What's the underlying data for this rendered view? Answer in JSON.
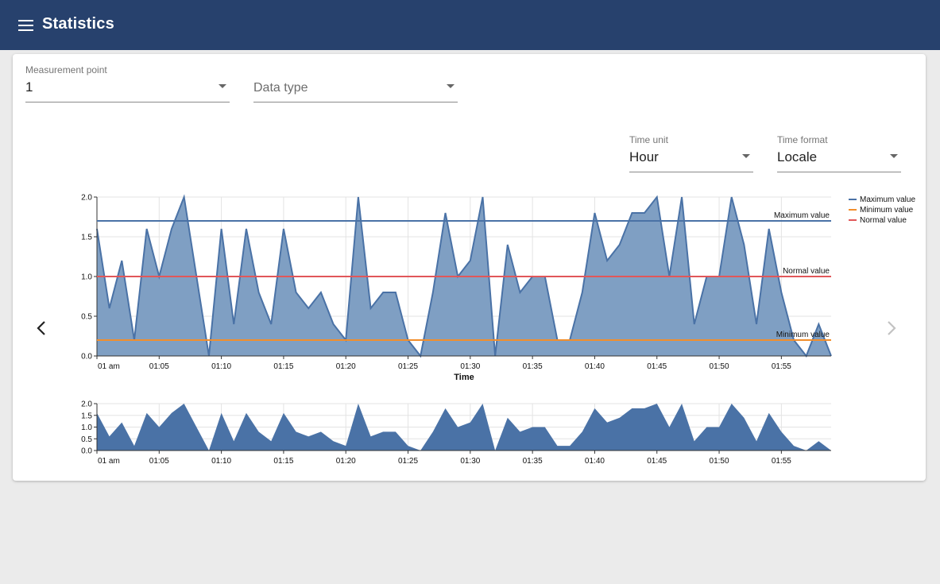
{
  "app": {
    "title": "Statistics"
  },
  "filters": {
    "measurement_point": {
      "label": "Measurement point",
      "value": "1"
    },
    "data_type": {
      "placeholder": "Data type"
    },
    "time_unit": {
      "label": "Time unit",
      "value": "Hour"
    },
    "time_format": {
      "label": "Time format",
      "value": "Locale"
    }
  },
  "colors": {
    "appbar": "#27416d",
    "area_fill": "#7f9fc3",
    "area_line": "#4a72a6",
    "max_line": "#4a72a6",
    "min_line": "#f28e2b",
    "normal_line": "#e15759"
  },
  "icons": {
    "menu": "menu-icon",
    "prev": "chevron-left-icon",
    "next": "chevron-right-icon"
  },
  "chart_data": [
    {
      "type": "area",
      "xlabel": "Time",
      "ylabel": "",
      "ylim": [
        0,
        2
      ],
      "yticks": [
        "0.0",
        "0.5",
        "1.0",
        "1.5",
        "2.0"
      ],
      "xtick_labels": [
        "01 am",
        "01:05",
        "01:10",
        "01:15",
        "01:20",
        "01:25",
        "01:30",
        "01:35",
        "01:40",
        "01:45",
        "01:50",
        "01:55"
      ],
      "x_start_minute": 0,
      "x_end_minute": 59,
      "values": [
        1.6,
        0.6,
        1.2,
        0.2,
        1.6,
        1.0,
        1.6,
        2.0,
        1.0,
        0.0,
        1.6,
        0.4,
        1.6,
        0.8,
        0.4,
        1.6,
        0.8,
        0.6,
        0.8,
        0.4,
        0.2,
        2.0,
        0.6,
        0.8,
        0.8,
        0.2,
        0.0,
        0.8,
        1.8,
        1.0,
        1.2,
        2.0,
        0.0,
        1.4,
        0.8,
        1.0,
        1.0,
        0.2,
        0.2,
        0.8,
        1.8,
        1.2,
        1.4,
        1.8,
        1.8,
        2.0,
        1.0,
        2.0,
        0.4,
        1.0,
        1.0,
        2.0,
        1.4,
        0.4,
        1.6,
        0.8,
        0.2,
        0.0,
        0.4,
        0.0
      ],
      "reference_lines": [
        {
          "name": "Maximum value",
          "label": "Maximum value",
          "value": 1.7
        },
        {
          "name": "Minimum value",
          "label": "Minimum value",
          "value": 0.2
        },
        {
          "name": "Normal value",
          "label": "Normal value",
          "value": 1.0
        }
      ],
      "legend": [
        "Maximum value",
        "Minimum value",
        "Normal value"
      ],
      "legend_position": "top-right",
      "grid": true
    },
    {
      "type": "area",
      "ylim": [
        0,
        2
      ],
      "yticks": [
        "0.0",
        "0.5",
        "1.0",
        "1.5",
        "2.0"
      ],
      "xtick_labels": [
        "01 am",
        "01:05",
        "01:10",
        "01:15",
        "01:20",
        "01:25",
        "01:30",
        "01:35",
        "01:40",
        "01:45",
        "01:50",
        "01:55"
      ],
      "grid": true
    }
  ]
}
